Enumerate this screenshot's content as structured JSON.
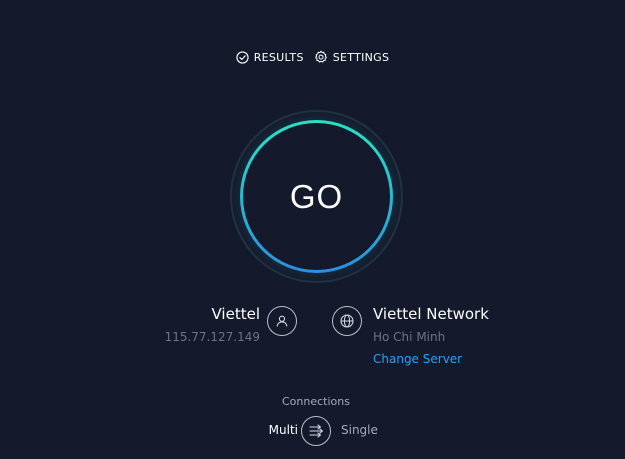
{
  "nav": {
    "results_label": "RESULTS",
    "settings_label": "SETTINGS"
  },
  "go": {
    "label": "GO"
  },
  "isp": {
    "name": "Viettel",
    "ip": "115.77.127.149"
  },
  "server": {
    "name": "Viettel Network",
    "location": "Ho Chi Minh",
    "change_label": "Change Server"
  },
  "connections": {
    "label": "Connections",
    "multi_label": "Multi",
    "single_label": "Single"
  },
  "icons": {
    "results": "check-circle-icon",
    "settings": "gear-icon",
    "isp": "user-icon",
    "server": "globe-icon",
    "connections": "arrows-toggle-icon"
  },
  "colors": {
    "background": "#141a2b",
    "accent_teal": "#2ce0c4",
    "accent_blue": "#2a8fe3",
    "link": "#2f9ff0",
    "muted_text": "#6b7385"
  }
}
